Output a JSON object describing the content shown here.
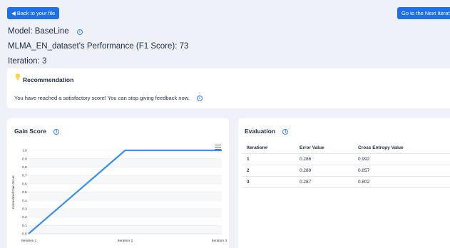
{
  "nav": {
    "back_label": "Back to your file",
    "next_label": "Go to the Next Iteration"
  },
  "header": {
    "model_label": "Model: BaseLine",
    "performance_label": "MLMA_EN_dataset's Performance (F1 Score): 73",
    "iteration_label": "Iteration: 3"
  },
  "recommendation": {
    "title": "Recommendation",
    "message": "You have reached a satisfactory score! You can stop giving feedback now."
  },
  "gain_score": {
    "title": "Gain Score"
  },
  "chart_data": {
    "type": "line",
    "categories": [
      "Iteration 1",
      "Iteration 2",
      "Iteration 3"
    ],
    "series": [
      {
        "values": [
          0.0,
          1.0,
          1.0
        ]
      }
    ],
    "ylabel": "Normalized Gain Score",
    "xlabel": "",
    "ylim": [
      0,
      1.0
    ],
    "yticks": [
      "0.0",
      "0.1",
      "0.2",
      "0.3",
      "0.4",
      "0.5",
      "0.6",
      "0.7",
      "0.8",
      "0.9",
      "1.0"
    ],
    "grid": true,
    "color": "#3b8ff0"
  },
  "evaluation": {
    "title": "Evaluation",
    "columns": [
      "Iteration#",
      "Error Value",
      "Cross Entropy Value"
    ],
    "rows": [
      [
        "1",
        "0.286",
        "0.992"
      ],
      [
        "2",
        "0.289",
        "0.857"
      ],
      [
        "3",
        "0.287",
        "0.802"
      ]
    ]
  },
  "colors": {
    "accent": "#1f6fe5",
    "background": "#eef1f7",
    "bulb": "#f8d54a"
  }
}
